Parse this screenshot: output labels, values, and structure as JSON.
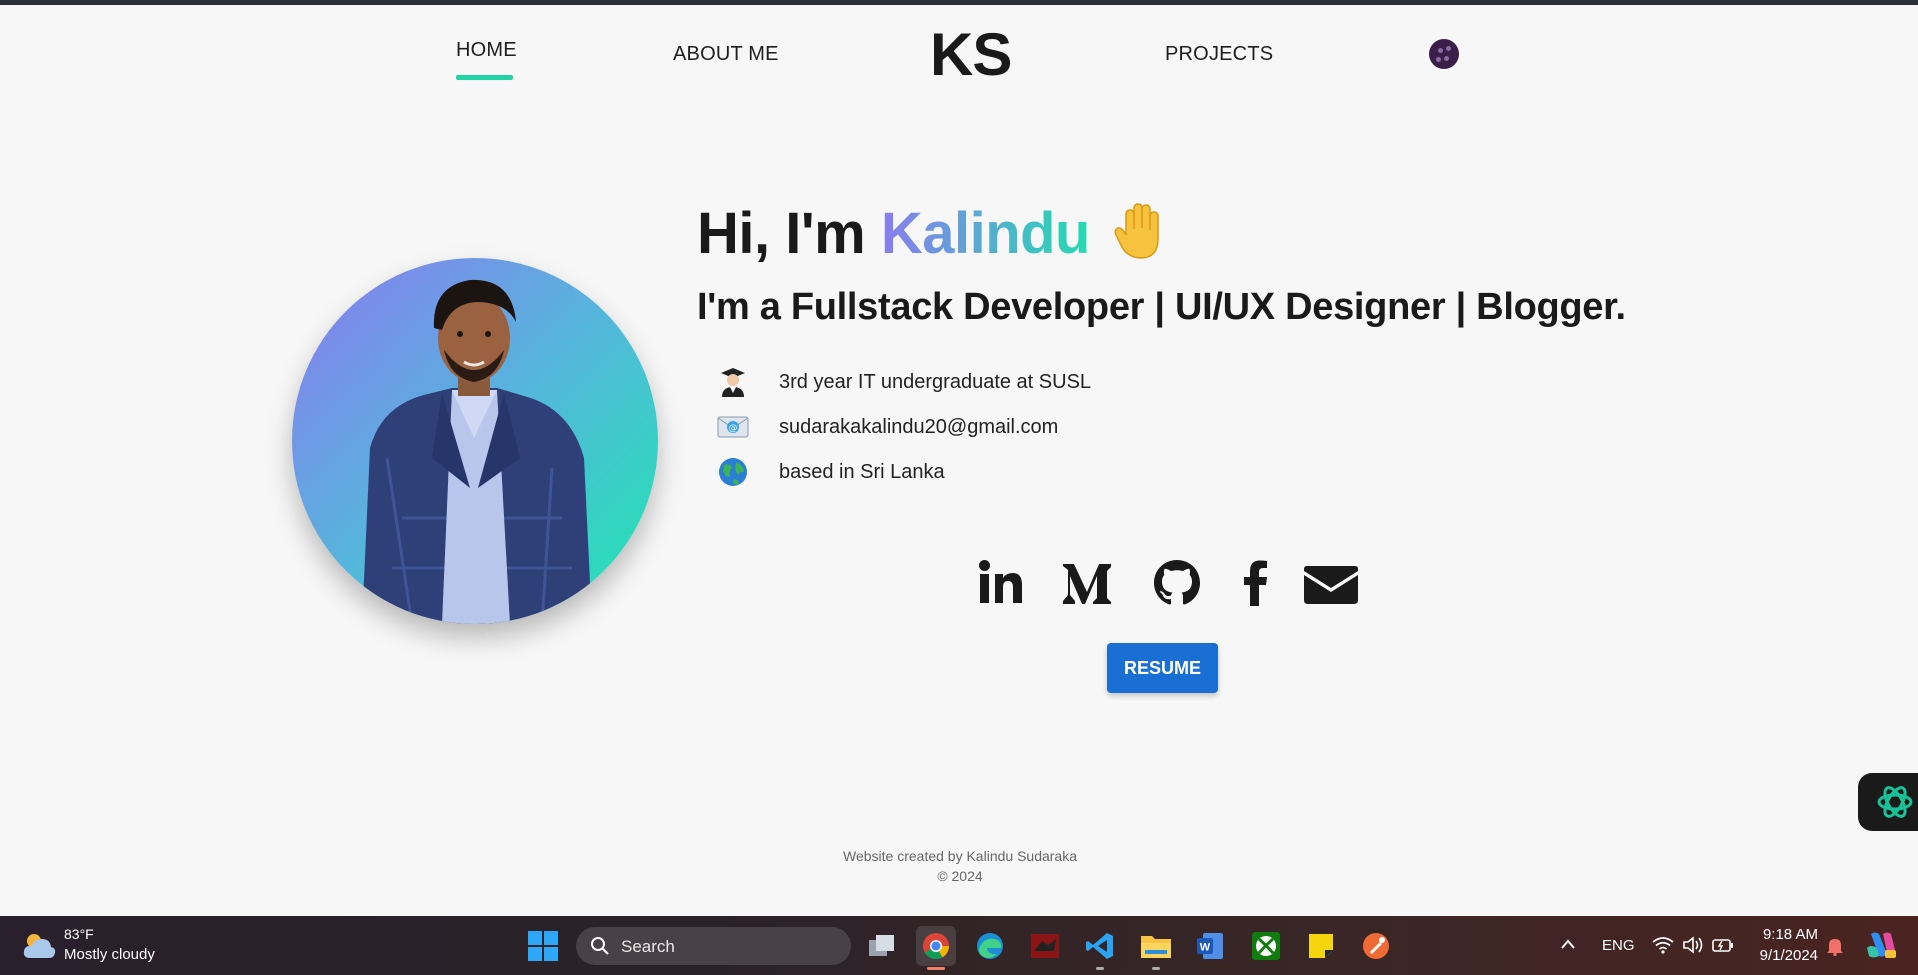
{
  "nav": {
    "home": "HOME",
    "about": "ABOUT ME",
    "logo": "KS",
    "projects": "PROJECTS"
  },
  "hero": {
    "greeting": "Hi, I'm ",
    "name": "Kalindu",
    "subtitle": "I'm a Fullstack Developer | UI/UX Designer | Blogger."
  },
  "info": [
    {
      "icon": "graduate-icon",
      "text": "3rd year IT undergraduate at SUSL"
    },
    {
      "icon": "email-icon",
      "text": "sudarakakalindu20@gmail.com"
    },
    {
      "icon": "globe-icon",
      "text": "based in Sri Lanka"
    }
  ],
  "socials": [
    "linkedin-icon",
    "medium-icon",
    "github-icon",
    "facebook-icon",
    "envelope-icon"
  ],
  "resume_label": "RESUME",
  "footer": {
    "credit": "Website created by Kalindu Sudaraka",
    "copyright": "© 2024"
  },
  "taskbar": {
    "weather_temp": "83°F",
    "weather_desc": "Mostly cloudy",
    "search_label": "Search",
    "language": "ENG",
    "time": "9:18 AM",
    "date": "9/1/2024"
  },
  "colors": {
    "accent_gradient_start": "#8b7cf0",
    "accent_gradient_end": "#22dcb0",
    "resume_button": "#1a6fd4",
    "page_background": "#f7f7f7"
  }
}
